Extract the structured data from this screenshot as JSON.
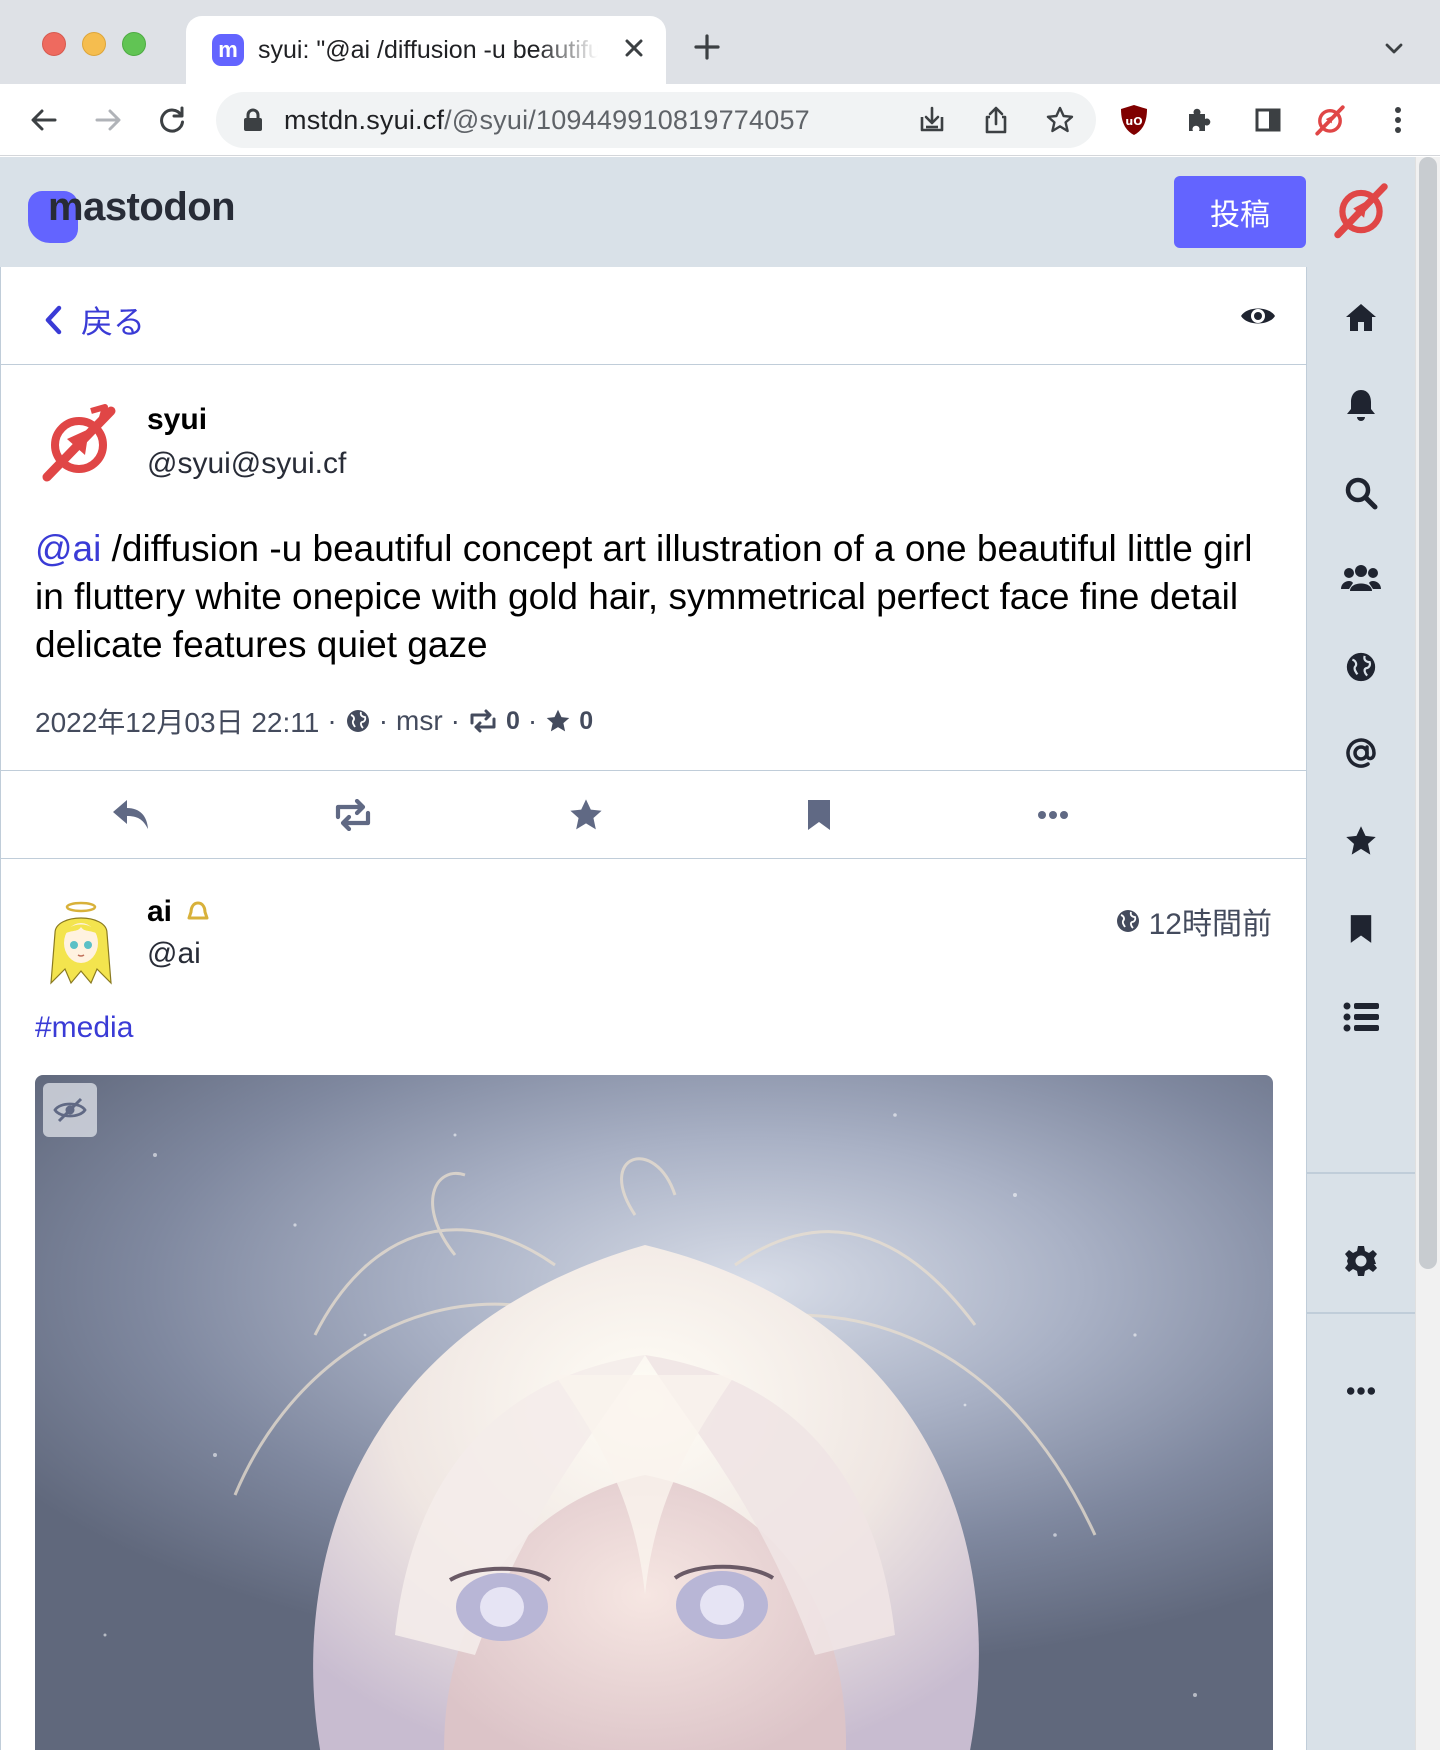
{
  "browser": {
    "tab_title": "syui: \"@ai /diffusion -u beautiful",
    "url_host": "mstdn.syui.cf",
    "url_path": "/@syui/109449910819774057"
  },
  "header": {
    "logo_text": "mastodon",
    "post_button": "投稿"
  },
  "column": {
    "back_label": "戻る"
  },
  "status": {
    "display_name": "syui",
    "acct": "@syui@syui.cf",
    "mention": "@ai",
    "text": " /diffusion -u beautiful concept art illustration of a one beautiful little girl in fluttery white onepice with gold hair, symmetrical perfect face fine detail delicate features quiet gaze",
    "date": "2022年12月03日 22:11",
    "application": "msr",
    "boosts": "0",
    "favourites": "0"
  },
  "reply": {
    "display_name": "ai",
    "acct": "@ai",
    "relative_time": "12時間前",
    "hashtag": "#media"
  },
  "icons": {
    "tab": [
      "mastodon-favicon",
      "close-icon",
      "plus-icon",
      "chevron-down-icon"
    ],
    "toolbar": [
      "back-arrow-icon",
      "forward-arrow-icon",
      "reload-icon",
      "lock-icon",
      "install-icon",
      "share-icon",
      "star-icon",
      "ublock-icon",
      "puzzle-icon",
      "sidebar-icon",
      "profile-icon",
      "kebab-icon"
    ],
    "nav": [
      "home-icon",
      "bell-icon",
      "search-icon",
      "users-icon",
      "globe-icon",
      "at-icon",
      "star-icon",
      "bookmark-icon",
      "list-icon",
      "gear-icon",
      "ellipsis-icon"
    ]
  },
  "colors": {
    "accent": "#6364ff",
    "link": "#3a3bd6",
    "header_bg": "#d9e1e8",
    "icon_gray": "#606984",
    "avatar_red": "#e04646"
  }
}
